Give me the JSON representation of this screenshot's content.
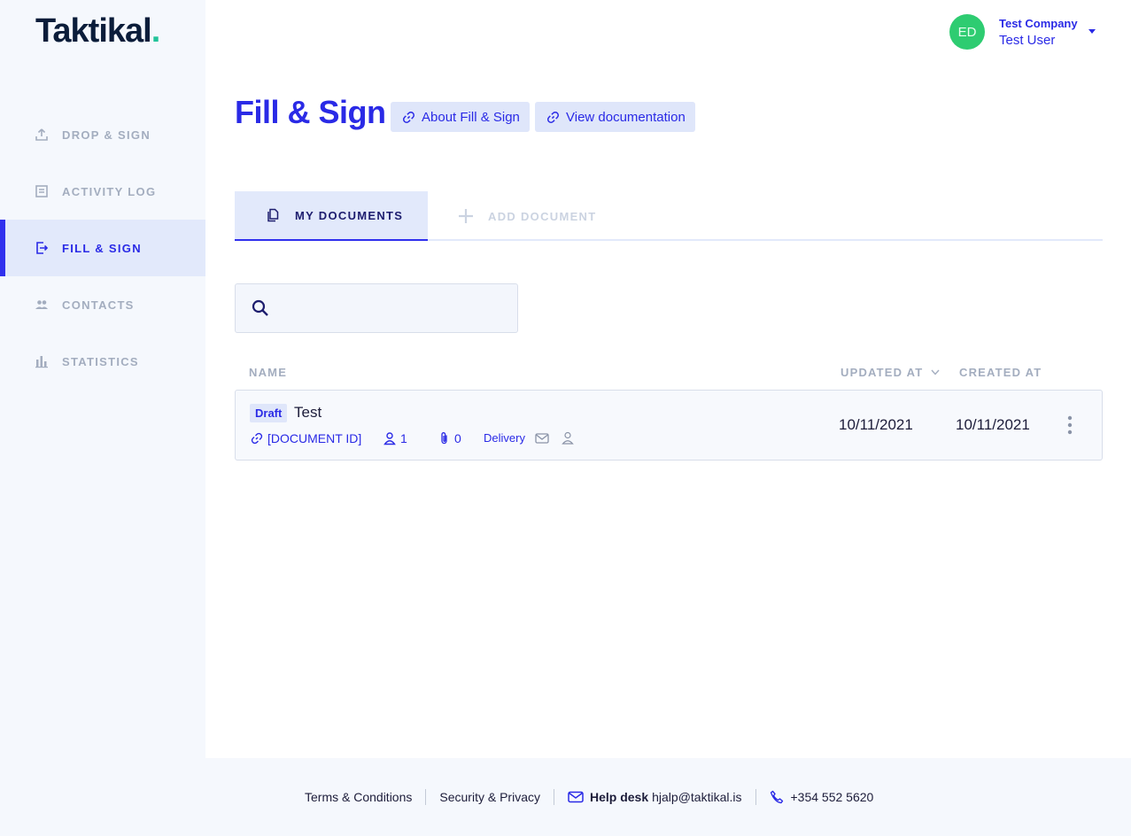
{
  "logo": {
    "text": "Taktikal",
    "dot": "."
  },
  "sidebar": {
    "items": [
      {
        "label": "DROP & SIGN",
        "icon": "upload-icon"
      },
      {
        "label": "ACTIVITY LOG",
        "icon": "list-icon"
      },
      {
        "label": "FILL & SIGN",
        "icon": "fill-sign-icon",
        "active": true
      },
      {
        "label": "CONTACTS",
        "icon": "people-icon"
      },
      {
        "label": "STATISTICS",
        "icon": "bar-chart-icon"
      }
    ]
  },
  "user": {
    "initials": "ED",
    "company": "Test Company",
    "name": "Test User"
  },
  "page": {
    "title": "Fill & Sign",
    "links": [
      "About Fill & Sign",
      "View documentation"
    ]
  },
  "tabs": [
    {
      "label": "MY DOCUMENTS",
      "active": true
    },
    {
      "label": "ADD DOCUMENT",
      "active": false
    }
  ],
  "search": {
    "placeholder": ""
  },
  "table": {
    "headers": {
      "name": "NAME",
      "updated": "UPDATED AT",
      "created": "CREATED AT"
    },
    "rows": [
      {
        "status": "Draft",
        "name": "Test",
        "document_id": "[DOCUMENT ID]",
        "signers": "1",
        "attachments": "0",
        "delivery_label": "Delivery",
        "updated": "10/11/2021",
        "created": "10/11/2021"
      }
    ]
  },
  "footer": {
    "terms": "Terms & Conditions",
    "privacy": "Security & Privacy",
    "helpdesk_label": "Help desk",
    "helpdesk_email": "hjalp@taktikal.is",
    "phone": "+354 552 5620"
  },
  "colors": {
    "accent": "#2a2ae6",
    "brand_dot": "#22c39a",
    "avatar": "#2ecc71",
    "sidebar_bg": "#f5f8fd"
  }
}
